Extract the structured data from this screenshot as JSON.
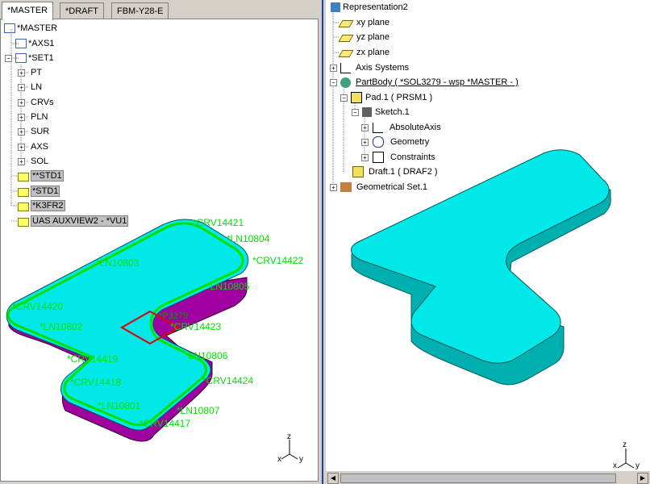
{
  "left_panel": {
    "tabs": [
      "*MASTER",
      "*DRAFT",
      "FBM-Y28-E"
    ],
    "tree": {
      "root": "*MASTER",
      "axs": "*AXS1",
      "set": "*SET1",
      "children": [
        "PT",
        "LN",
        "CRVs",
        "PLN",
        "SUR",
        "AXS",
        "SOL"
      ],
      "folders": [
        "**STD1",
        "*STD1",
        "*K3FR2",
        "UAS AUXVIEW2 - *VU1"
      ]
    },
    "labels": {
      "crv14421": "*CRV14421",
      "ln10804": "*LN10804",
      "ln10803": "*LN10803",
      "crv14422": "*CRV14422",
      "ln10805": "*LN10805",
      "crv14420": "*CRV14420",
      "ln10802": "*LN10802",
      "crv14423": "*CRV14423",
      "ln10806": "*LN10806",
      "crv14419": "*CRV14419",
      "crv14418": "*CRV14418",
      "crv14424": "*CRV14424",
      "ln10801": "*LN10801",
      "ln10807": "*LN10807",
      "crv14417": "*CRV14417",
      "pt": "*P3279"
    },
    "axes": {
      "z": "z",
      "x": "x",
      "y": "y"
    }
  },
  "right_panel": {
    "tree": {
      "root": "Representation2",
      "planes": [
        "xy plane",
        "yz plane",
        "zx plane"
      ],
      "axis_systems": "Axis Systems",
      "partbody": "PartBody ( *SOL3279 - wsp *MASTER -  )",
      "pad": "Pad.1 ( PRSM1 )",
      "sketch": "Sketch.1",
      "sketch_children": [
        "AbsoluteAxis",
        "Geometry",
        "Constraints"
      ],
      "draft": "Draft.1 ( DRAF2 )",
      "geoset": "Geometrical Set.1"
    },
    "axes": {
      "z": "z",
      "x": "x",
      "y": "y"
    }
  },
  "colors": {
    "solid": "#00e8e8",
    "side": "#00b0b0",
    "purple": "#a000a0",
    "curve": "#00e000",
    "accent": "#2040a0"
  }
}
